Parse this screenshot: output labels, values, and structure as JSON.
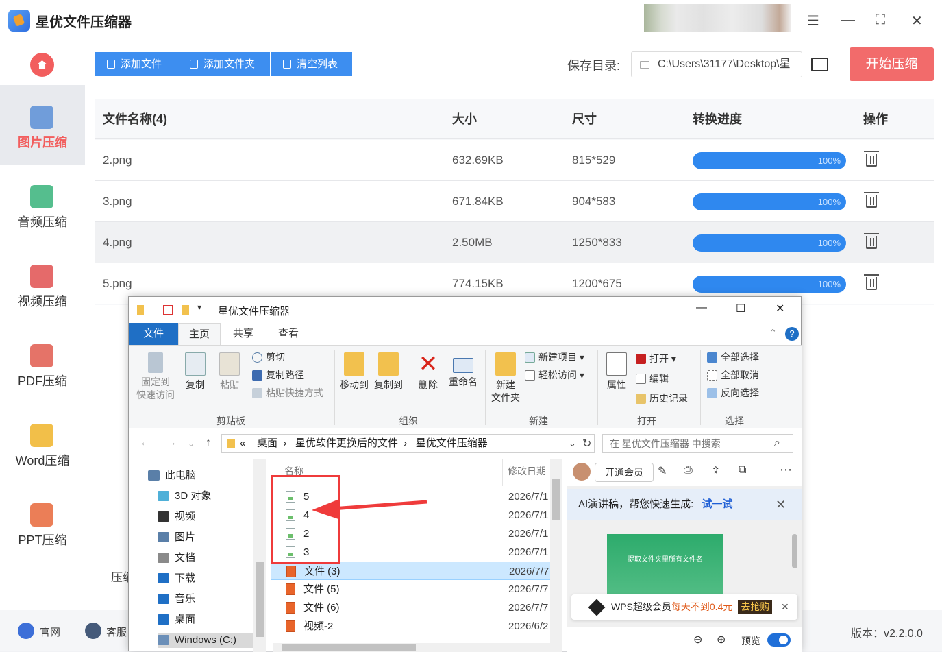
{
  "app": {
    "title": "星优文件压缩器"
  },
  "sidebar": {
    "items": [
      {
        "label": "图片压缩",
        "icon": "image-icon",
        "active": true,
        "color": "#5b8fd6"
      },
      {
        "label": "音频压缩",
        "icon": "music-icon",
        "active": false,
        "color": "#37b37a"
      },
      {
        "label": "视频压缩",
        "icon": "video-icon",
        "active": false,
        "color": "#e05050"
      },
      {
        "label": "PDF压缩",
        "icon": "pdf-icon",
        "active": false,
        "color": "#e05a4e"
      },
      {
        "label": "Word压缩",
        "icon": "word-icon",
        "active": false,
        "color": "#f0b429"
      },
      {
        "label": "PPT压缩",
        "icon": "ppt-icon",
        "active": false,
        "color": "#e8673a"
      }
    ]
  },
  "toolbar": {
    "add_file": "添加文件",
    "add_folder": "添加文件夹",
    "clear_list": "清空列表",
    "save_label": "保存目录:",
    "save_path": "C:\\Users\\31177\\Desktop\\星",
    "start": "开始压缩"
  },
  "table": {
    "headers": [
      "文件名称(4)",
      "大小",
      "尺寸",
      "转换进度",
      "操作"
    ],
    "rows": [
      {
        "name": "2.png",
        "size": "632.69KB",
        "dim": "815*529",
        "progress": "100%"
      },
      {
        "name": "3.png",
        "size": "671.84KB",
        "dim": "904*583",
        "progress": "100%"
      },
      {
        "name": "4.png",
        "size": "2.50MB",
        "dim": "1250*833",
        "progress": "100%"
      },
      {
        "name": "5.png",
        "size": "774.15KB",
        "dim": "1200*675",
        "progress": "100%"
      }
    ]
  },
  "bottom": {
    "website": "官网",
    "service": "客服",
    "version": "版本：v2.2.0.0",
    "partial_label": "压缩"
  },
  "explorer": {
    "title": "星优文件压缩器",
    "tabs": [
      "文件",
      "主页",
      "共享",
      "查看"
    ],
    "ribbon": {
      "pin": "固定到\n快速访问",
      "copy": "复制",
      "paste": "粘贴",
      "cut": "剪切",
      "copy_path": "复制路径",
      "paste_shortcut": "粘贴快捷方式",
      "move_to": "移动到",
      "copy_to": "复制到",
      "delete": "删除",
      "rename": "重命名",
      "new_folder": "新建\n文件夹",
      "new_item": "新建项目",
      "easy_access": "轻松访问",
      "properties": "属性",
      "open": "打开",
      "edit": "编辑",
      "history": "历史记录",
      "select_all": "全部选择",
      "select_none": "全部取消",
      "invert": "反向选择",
      "groups": [
        "剪贴板",
        "组织",
        "新建",
        "打开",
        "选择"
      ]
    },
    "address": {
      "crumbs": [
        "«",
        "桌面",
        "星优软件更换后的文件",
        "星优文件压缩器"
      ],
      "search_placeholder": "在 星优文件压缩器 中搜索"
    },
    "tree": [
      "此电脑",
      "3D 对象",
      "视频",
      "图片",
      "文档",
      "下载",
      "音乐",
      "桌面",
      "Windows (C:)"
    ],
    "columns": {
      "name": "名称",
      "modified": "修改日期"
    },
    "files": [
      {
        "name": "5",
        "date": "2026/7/1",
        "type": "img"
      },
      {
        "name": "4",
        "date": "2026/7/1",
        "type": "img"
      },
      {
        "name": "2",
        "date": "2026/7/1",
        "type": "img"
      },
      {
        "name": "3",
        "date": "2026/7/1",
        "type": "img"
      },
      {
        "name": "文件 (3)",
        "date": "2026/7/7",
        "type": "wps"
      },
      {
        "name": "文件 (5)",
        "date": "2026/7/7",
        "type": "wps"
      },
      {
        "name": "文件 (6)",
        "date": "2026/7/7",
        "type": "wps"
      },
      {
        "name": "视频-2",
        "date": "2026/6/2",
        "type": "wps"
      }
    ],
    "preview": {
      "member": "开通会员",
      "ai_text": "AI演讲稿，帮您快速生成:",
      "ai_link": "试一试",
      "doc_title": "提取文件夹里所有文件名",
      "wps_text": "WPS超级会员",
      "wps_highlight": "每天不到0.4元",
      "wps_btn": "去抢购",
      "preview_label": "预览"
    }
  }
}
